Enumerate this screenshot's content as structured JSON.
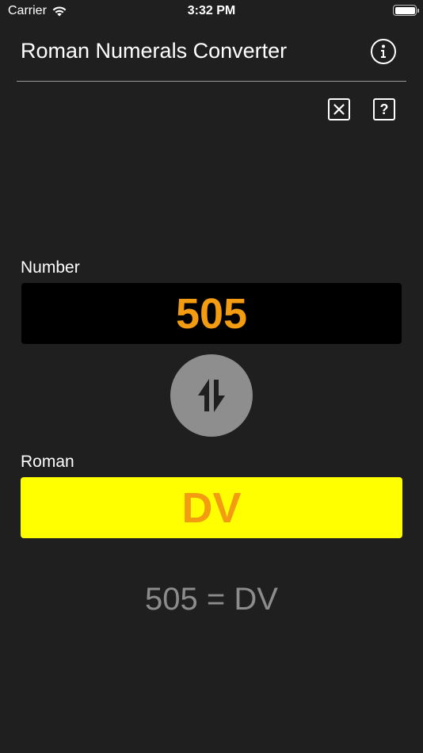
{
  "status_bar": {
    "carrier": "Carrier",
    "time": "3:32 PM",
    "wifi_icon": "wifi-icon",
    "battery_icon": "battery-icon"
  },
  "header": {
    "title": "Roman Numerals Converter",
    "info_icon": "info-icon"
  },
  "toolbar": {
    "clear_icon": "close-box-icon",
    "help_label": "?"
  },
  "number": {
    "label": "Number",
    "value": "505"
  },
  "swap": {
    "icon": "swap-arrows-icon"
  },
  "roman": {
    "label": "Roman",
    "value": "DV"
  },
  "result": {
    "text": "505 = DV"
  },
  "colors": {
    "background": "#1f1f1f",
    "accent_orange": "#f39c12",
    "roman_field_bg": "#ffff00",
    "number_field_bg": "#000000",
    "swap_button_bg": "#8e8e8e",
    "result_text": "#8c8c8c"
  }
}
